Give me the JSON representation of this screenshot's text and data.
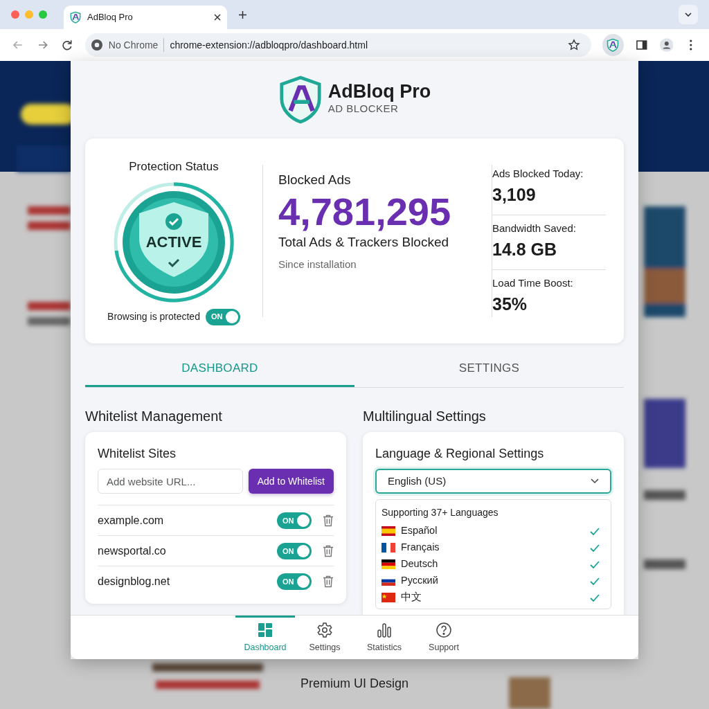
{
  "browser": {
    "tab_title": "AdBloq Pro",
    "security_label": "No Chrome",
    "url": "chrome-extension://adbloqpro/dashboard.html"
  },
  "brand": {
    "name": "AdBloq Pro",
    "subtitle": "AD BLOCKER"
  },
  "protection": {
    "title": "Protection Status",
    "status": "ACTIVE",
    "toggle_text": "Browsing is protected",
    "toggle": {
      "on": true,
      "label": "ON"
    }
  },
  "blocked": {
    "title": "Blocked Ads",
    "value": "4,781,295",
    "caption": "Total Ads & Trackers Blocked",
    "note": "Since installation"
  },
  "side_stats": [
    {
      "label": "Ads Blocked Today:",
      "value": "3,109"
    },
    {
      "label": "Bandwidth Saved:",
      "value": "14.8 GB"
    },
    {
      "label": "Load Time Boost:",
      "value": "35%"
    }
  ],
  "tabs": [
    {
      "label": "DASHBOARD",
      "selected": true
    },
    {
      "label": "SETTINGS",
      "selected": false
    }
  ],
  "whitelist": {
    "heading": "Whitelist Management",
    "card_title": "Whitelist Sites",
    "input": {
      "placeholder": "Add website URL..."
    },
    "button": "Add to Whitelist",
    "sites": [
      {
        "domain": "example.com",
        "on": true,
        "toggle_label": "ON"
      },
      {
        "domain": "newsportal.co",
        "on": true,
        "toggle_label": "ON"
      },
      {
        "domain": "designblog.net",
        "on": true,
        "toggle_label": "ON"
      }
    ]
  },
  "multilingual": {
    "heading": "Multilingual Settings",
    "card_title": "Language & Regional Settings",
    "select_value": "English (US)",
    "list_header": "Supporting 37+ Languages",
    "languages": [
      {
        "name": "Español",
        "kind": "es",
        "checked": true
      },
      {
        "name": "Français",
        "kind": "fr",
        "checked": true
      },
      {
        "name": "Deutsch",
        "kind": "de",
        "checked": true
      },
      {
        "name": "Русский",
        "kind": "ru",
        "checked": true
      },
      {
        "name": "中文",
        "kind": "cn",
        "checked": true
      }
    ]
  },
  "bottom_nav": [
    {
      "label": "Dashboard",
      "kind": "dashboard",
      "selected": true
    },
    {
      "label": "Settings",
      "kind": "settings",
      "selected": false
    },
    {
      "label": "Statistics",
      "kind": "statistics",
      "selected": false
    },
    {
      "label": "Support",
      "kind": "support",
      "selected": false
    }
  ],
  "caption": "Premium UI Design"
}
